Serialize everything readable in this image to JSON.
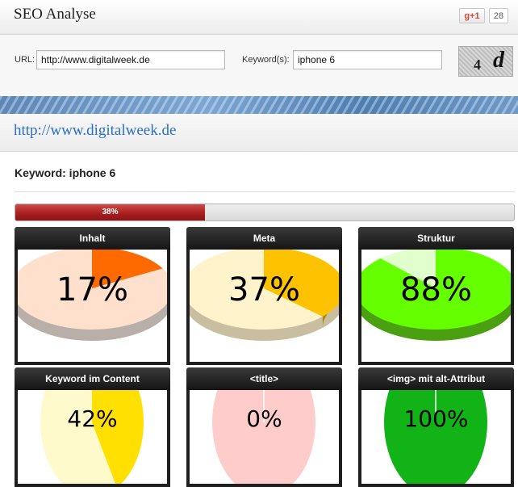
{
  "header": {
    "title": "SEO Analyse",
    "gplus_label": "g+1",
    "gplus_count": "28"
  },
  "form": {
    "url_label": "URL:",
    "url_value": "http://www.digitalweek.de",
    "keyword_label": "Keyword(s):",
    "keyword_value": "iphone 6",
    "captcha_chars": [
      "4",
      "d"
    ]
  },
  "result": {
    "url_link": "http://www.digitalweek.de",
    "keyword_line": "Keyword: iphone 6",
    "overall_progress": 0.38,
    "overall_label": "38%"
  },
  "cards": [
    {
      "title": "Inhalt",
      "percent": 17,
      "label": "17%",
      "color_main": "#ff6a00",
      "color_rest": "#ffe0cc",
      "side_main": "#b8b0a8",
      "side_rest": "#b8b0a8"
    },
    {
      "title": "Meta",
      "percent": 37,
      "label": "37%",
      "color_main": "#ffc200",
      "color_rest": "#fff3cc",
      "side_main": "#a88a10",
      "side_rest": "#c9bfa0"
    },
    {
      "title": "Struktur",
      "percent": 88,
      "label": "88%",
      "color_main": "#66ff00",
      "color_rest": "#e0ffcc",
      "side_main": "#4aa010",
      "side_rest": "#4aa010"
    },
    {
      "title": "Keyword im Content",
      "percent": 42,
      "label": "42%",
      "color_main": "#ffe000",
      "color_rest": "#fffacc"
    },
    {
      "title": "<title>",
      "percent": 0,
      "label": "0%",
      "color_main": "#ff6666",
      "color_rest": "#ffcccc"
    },
    {
      "title": "<img> mit alt-Attribut",
      "percent": 100,
      "label": "100%",
      "color_main": "#12b317",
      "color_rest": "#d0f0d0"
    }
  ]
}
